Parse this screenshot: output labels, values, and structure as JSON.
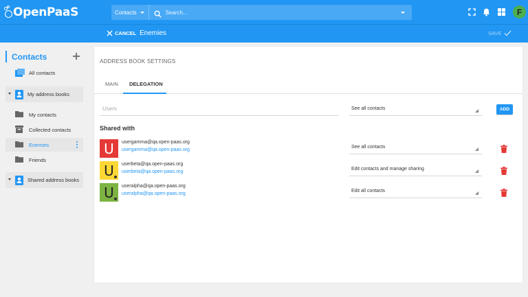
{
  "app": {
    "logo_text": "OpenPaaS",
    "user_initial": "F"
  },
  "search": {
    "scope": "Contacts",
    "placeholder": "Search..."
  },
  "subheader": {
    "cancel_label": "CANCEL",
    "title": "Enemies",
    "save_label": "SAVE"
  },
  "sidebar": {
    "title": "Contacts",
    "all_contacts": "All contacts",
    "my_address_books_label": "My address books",
    "books": [
      {
        "label": "My contacts"
      },
      {
        "label": "Collected contacts"
      },
      {
        "label": "Enemies",
        "active": true
      },
      {
        "label": "Friends"
      }
    ],
    "shared_address_books_label": "Shared address books"
  },
  "main": {
    "section_title": "ADDRESS BOOK SETTINGS",
    "tabs": [
      {
        "label": "MAIN"
      },
      {
        "label": "DELEGATION",
        "active": true
      }
    ],
    "users_placeholder": "Users",
    "new_permission": "See all contacts",
    "add_label": "ADD",
    "shared_with_label": "Shared with",
    "shares": [
      {
        "initial": "U",
        "avatar_color": "#e53935",
        "text_color": "#ffffff",
        "name": "usergamma@qa.open-paas.org",
        "email": "usergamma@qa.open-paas.org",
        "permission": "See all contacts"
      },
      {
        "initial": "U",
        "avatar_color": "#fdd835",
        "text_color": "#222222",
        "name": "userbeta@qa.open-paas.org",
        "email": "userbeta@qa.open-paas.org",
        "permission": "Edit contacts and manage sharing"
      },
      {
        "initial": "U",
        "avatar_color": "#7cb342",
        "text_color": "#222222",
        "name": "useralpha@qa.open-paas.org",
        "email": "useralpha@qa.open-paas.org",
        "permission": "Edit all contacts"
      }
    ]
  },
  "colors": {
    "primary": "#2196f3",
    "danger": "#e53935"
  }
}
